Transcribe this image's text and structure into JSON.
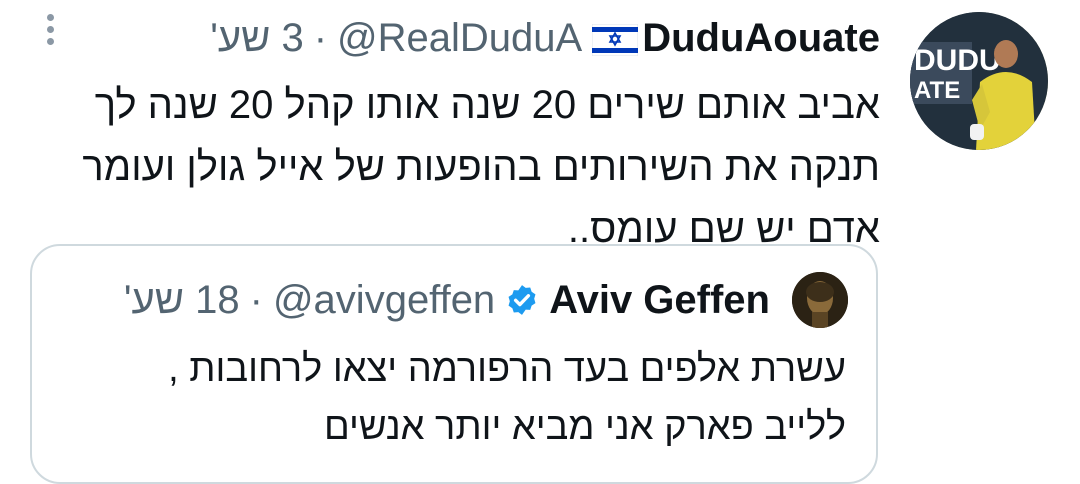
{
  "tweet": {
    "author": {
      "display_name": "DuduAouate",
      "flag": "israel-flag-icon",
      "handle": "@RealDuduA",
      "time": "3 שע'"
    },
    "separator": "·",
    "text_lines": [
      "אביב אותם שירים 20 שנה אותו קהל 20 שנה לך",
      "תנקה את השירותים בהופעות של אייל גולן ועומר",
      "אדם יש שם עומס.."
    ],
    "avatar_text": "DUDU ATE"
  },
  "quoted": {
    "author": {
      "display_name": "Aviv Geffen",
      "verified": "verified-badge-icon",
      "handle": "@avivgeffen",
      "time": "18 שע'"
    },
    "separator": "·",
    "text_lines": [
      "עשרת אלפים בעד הרפורמה יצאו לרחובות ,",
      "ללייב פארק אני מביא יותר אנשים"
    ]
  },
  "colors": {
    "text": "#0f1419",
    "secondary": "#536471",
    "border": "#cfd9de",
    "verified": "#1d9bf0",
    "flag_blue": "#0038b8"
  }
}
